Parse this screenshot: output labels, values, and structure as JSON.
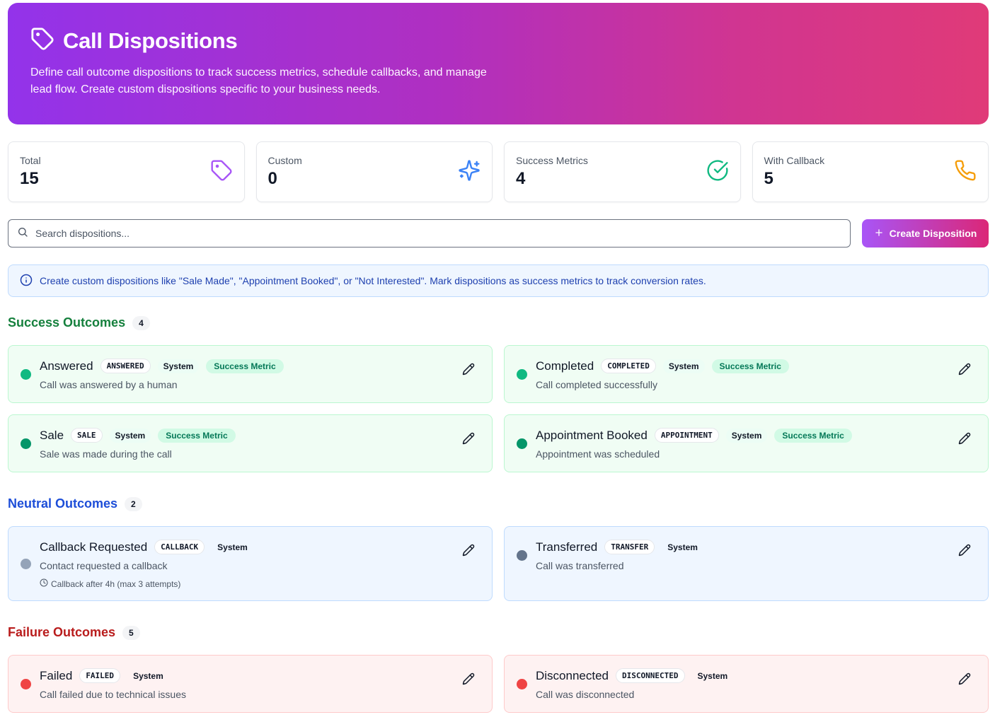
{
  "header": {
    "title": "Call Dispositions",
    "description": "Define call outcome dispositions to track success metrics, schedule callbacks, and manage lead flow. Create custom dispositions specific to your business needs.",
    "icon": "tag-icon"
  },
  "stats": [
    {
      "label": "Total",
      "value": "15",
      "icon": "tag-icon",
      "color": "#a855f7"
    },
    {
      "label": "Custom",
      "value": "0",
      "icon": "sparkles-icon",
      "color": "#3b82f6"
    },
    {
      "label": "Success Metrics",
      "value": "4",
      "icon": "check-circle-icon",
      "color": "#10b981"
    },
    {
      "label": "With Callback",
      "value": "5",
      "icon": "phone-icon",
      "color": "#f59e0b"
    }
  ],
  "search": {
    "placeholder": "Search dispositions..."
  },
  "create_button": {
    "label": "Create Disposition"
  },
  "info_banner": {
    "text": "Create custom dispositions like \"Sale Made\", \"Appointment Booked\", or \"Not Interested\". Mark dispositions as success metrics to track conversion rates."
  },
  "sections": {
    "success": {
      "title": "Success Outcomes",
      "count": "4",
      "color": "#15803d",
      "items": [
        {
          "name": "Answered",
          "code": "ANSWERED",
          "system": "System",
          "metric": "Success Metric",
          "desc": "Call was answered by a human",
          "dot": "#10b981"
        },
        {
          "name": "Completed",
          "code": "COMPLETED",
          "system": "System",
          "metric": "Success Metric",
          "desc": "Call completed successfully",
          "dot": "#10b981"
        },
        {
          "name": "Sale",
          "code": "SALE",
          "system": "System",
          "metric": "Success Metric",
          "desc": "Sale was made during the call",
          "dot": "#059669"
        },
        {
          "name": "Appointment Booked",
          "code": "APPOINTMENT",
          "system": "System",
          "metric": "Success Metric",
          "desc": "Appointment was scheduled",
          "dot": "#059669"
        }
      ]
    },
    "neutral": {
      "title": "Neutral Outcomes",
      "count": "2",
      "color": "#1d4ed8",
      "items": [
        {
          "name": "Callback Requested",
          "code": "CALLBACK",
          "system": "System",
          "desc": "Contact requested a callback",
          "callback": "Callback after 4h (max 3 attempts)",
          "dot": "#94a3b8"
        },
        {
          "name": "Transferred",
          "code": "TRANSFER",
          "system": "System",
          "desc": "Call was transferred",
          "dot": "#64748b"
        }
      ]
    },
    "failure": {
      "title": "Failure Outcomes",
      "count": "5",
      "color": "#b91c1c",
      "items": [
        {
          "name": "Failed",
          "code": "FAILED",
          "system": "System",
          "desc": "Call failed due to technical issues",
          "dot": "#ef4444"
        },
        {
          "name": "Disconnected",
          "code": "DISCONNECTED",
          "system": "System",
          "desc": "Call was disconnected",
          "dot": "#ef4444"
        }
      ]
    }
  }
}
